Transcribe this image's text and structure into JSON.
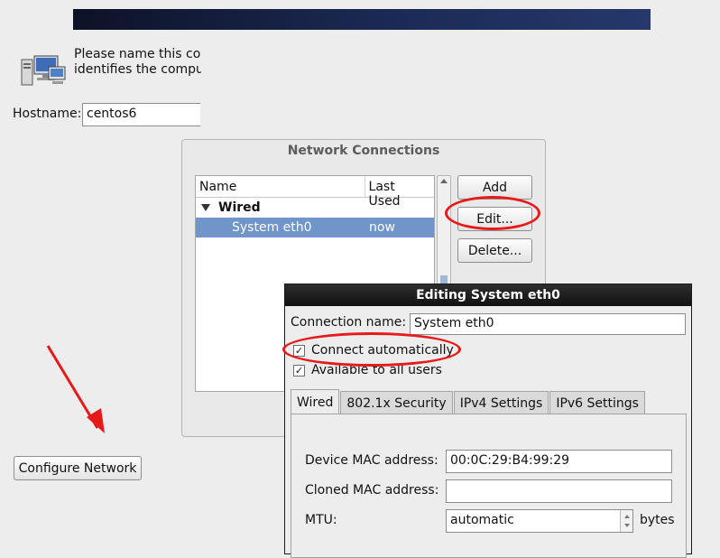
{
  "hostname_section": {
    "description": "Please name this computer. The hostname identifies the computer on a network.",
    "label": "Hostname:",
    "value": "centos6"
  },
  "network_connections": {
    "title": "Network Connections",
    "columns": [
      "Name",
      "Last Used"
    ],
    "group": "Wired",
    "rows": [
      {
        "name": "System eth0",
        "last_used": "now"
      }
    ],
    "buttons": {
      "add": "Add",
      "edit": "Edit...",
      "delete": "Delete..."
    }
  },
  "configure_button": "Configure Network",
  "edit_dialog": {
    "title": "Editing System eth0",
    "connection_name_label": "Connection name:",
    "connection_name": "System eth0",
    "connect_automatically": {
      "label": "Connect automatically",
      "checked": true
    },
    "available_all_users": {
      "label": "Available to all users",
      "checked": true
    },
    "tabs": [
      "Wired",
      "802.1x Security",
      "IPv4 Settings",
      "IPv6 Settings"
    ],
    "fields": {
      "device_mac_label": "Device MAC address:",
      "device_mac": "00:0C:29:B4:99:29",
      "cloned_mac_label": "Cloned MAC address:",
      "cloned_mac": "",
      "mtu_label": "MTU:",
      "mtu": "automatic",
      "mtu_unit": "bytes"
    }
  },
  "colors": {
    "annotation": "#e8191a",
    "selection": "#6f95c9",
    "banner": "#1b2a55"
  }
}
